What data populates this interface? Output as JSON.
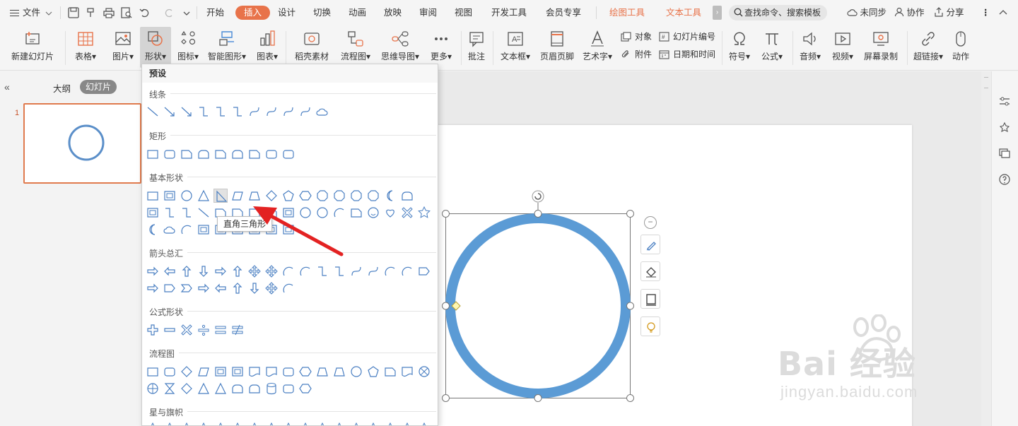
{
  "menubar": {
    "file_label": "文件",
    "tabs": [
      {
        "label": "开始"
      },
      {
        "label": "插入"
      },
      {
        "label": "设计"
      },
      {
        "label": "切换"
      },
      {
        "label": "动画"
      },
      {
        "label": "放映"
      },
      {
        "label": "审阅"
      },
      {
        "label": "视图"
      },
      {
        "label": "开发工具"
      },
      {
        "label": "会员专享"
      },
      {
        "label": "绘图工具"
      },
      {
        "label": "文本工具"
      }
    ],
    "search_placeholder": "查找命令、搜索模板",
    "sync_label": "未同步",
    "collab_label": "协作",
    "share_label": "分享",
    "accent_color": "#e8734a"
  },
  "ribbon": {
    "new_slide": "新建幻灯片",
    "table": "表格",
    "picture": "图片",
    "shape": "形状",
    "icon": "图标",
    "smart_art": "智能图形",
    "chart": "图表",
    "material": "稻壳素材",
    "flowchart": "流程图",
    "mindmap": "思维导图",
    "more": "更多",
    "comment": "批注",
    "textbox": "文本框",
    "header_footer": "页眉页脚",
    "wordart": "艺术字",
    "object": "对象",
    "attachment": "附件",
    "slide_number": "幻灯片编号",
    "datetime": "日期和时间",
    "symbol": "符号",
    "formula": "公式",
    "audio": "音频",
    "video": "视频",
    "screen_record": "屏幕录制",
    "hyperlink": "超链接",
    "action": "动作"
  },
  "leftpane": {
    "outline_tab": "大纲",
    "slides_tab": "幻灯片",
    "slide_number": "1"
  },
  "dropdown": {
    "header": "预设",
    "sections": {
      "lines": "线条",
      "rectangles": "矩形",
      "basic": "基本形状",
      "arrows": "箭头总汇",
      "equation": "公式形状",
      "flowchart": "流程图",
      "stars": "星与旗帜"
    },
    "tooltip": "直角三角形"
  },
  "slide": {
    "circle_color": "#5b9bd5"
  },
  "watermark": {
    "brand": "Bai 经验",
    "url": "jingyan.baidu.com"
  }
}
